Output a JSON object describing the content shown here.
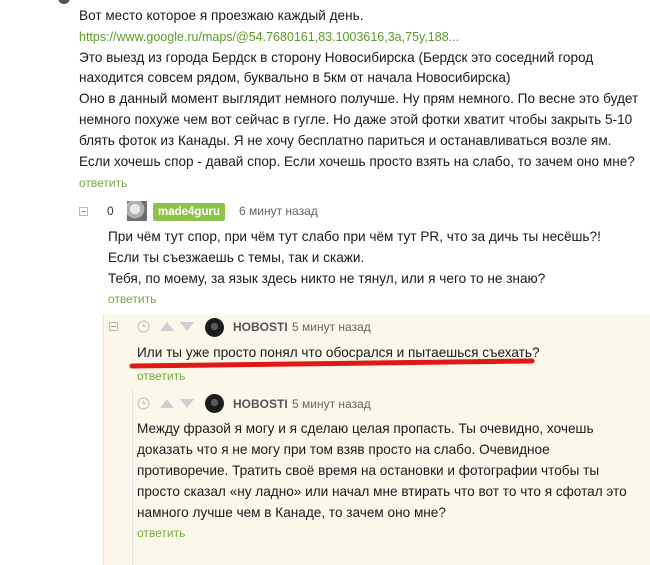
{
  "comment1": {
    "lines": [
      "Вот место которое я проезжаю каждый день.",
      "https://www.google.ru/maps/@54.7680161,83.1003616,3a,75y,188...",
      "Это выезд из города Бердск в сторону Новосибирска (Бердск это соседний город",
      "находится совсем рядом, буквально в 5км от начала Новосибирска)",
      "Оно в данный момент выглядит немного получше. Ну прям немного. По весне это будет",
      "немного похуже чем вот сейчас в гугле. Но даже этой фотки хватит чтобы закрыть 5-10",
      "блять фоток из Канады. Я не хочу бесплатно париться и останавливаться возле ям.",
      "Если хочешь спор - давай спор. Если хочешь просто взять на слабо, то зачем оно мне?"
    ],
    "reply_label": "ответить"
  },
  "comment2": {
    "rating": "0",
    "username": "made4guru",
    "time": "6 минут назад",
    "lines": [
      "При чём тут спор, при чём тут слабо при чём тут PR, что за дичь ты несёшь?!",
      "Если ты съезжаешь с темы, так и скажи.",
      "Тебя, по моему, за язык здесь никто не тянул,  или я чего то не знаю?"
    ],
    "reply_label": "ответить"
  },
  "comment3": {
    "username": "HOBOSTI",
    "time": "5 минут назад",
    "lines": [
      "Или ты уже просто понял что обосрался и пытаешься съехать?"
    ],
    "reply_label": "ответить",
    "underline_color": "#e01818"
  },
  "comment4": {
    "username": "HOBOSTI",
    "time": "5 минут назад",
    "lines": [
      "Между фразой я могу и я сделаю целая пропасть. Ты очевидно, хочешь",
      "доказать что я не могу при том взяв просто на слабо. Очевидное",
      "противоречие. Тратить своё время на остановки и фотографии чтобы ты",
      "просто сказал «ну ладно» или начал мне втирать что вот то что я сфотал это",
      "намного лучше чем в Канаде, то зачем оно мне?"
    ],
    "reply_label": "ответить"
  },
  "colors": {
    "link": "#5a9a2b",
    "reply": "#7aa843",
    "badge": "#8ec24a",
    "highlight_bg": "#fbf8e9"
  }
}
